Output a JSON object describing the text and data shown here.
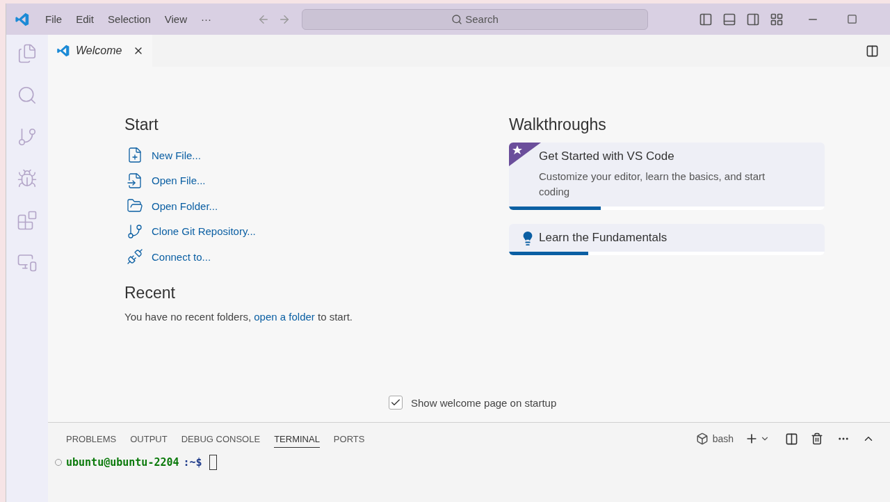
{
  "menu": [
    "File",
    "Edit",
    "Selection",
    "View",
    "···"
  ],
  "search": {
    "placeholder": "Search"
  },
  "editor_tabs": [
    {
      "label": "Welcome",
      "selected": true
    }
  ],
  "start": {
    "title": "Start",
    "items": [
      {
        "kind": "new-file",
        "label": "New File..."
      },
      {
        "kind": "open-file",
        "label": "Open File..."
      },
      {
        "kind": "open-folder",
        "label": "Open Folder..."
      },
      {
        "kind": "clone",
        "label": "Clone Git Repository..."
      },
      {
        "kind": "connect",
        "label": "Connect to..."
      }
    ]
  },
  "recent": {
    "title": "Recent",
    "text_before": "You have no recent folders,",
    "link": "open a folder",
    "text_after": "to start."
  },
  "walkthroughs": {
    "title": "Walkthroughs",
    "items": [
      {
        "kind": "featured",
        "title": "Get Started with VS Code",
        "description": "Customize your editor, learn the basics, and start coding",
        "level": 0.29
      },
      {
        "kind": "bulb",
        "title": "Learn the Fundamentals",
        "level": 0.25
      }
    ]
  },
  "show_on_startup": {
    "label": "Show welcome page on startup",
    "checked": true
  },
  "panel_tabs": [
    {
      "label": "PROBLEMS",
      "selected": false
    },
    {
      "label": "OUTPUT",
      "selected": false
    },
    {
      "label": "DEBUG CONSOLE",
      "selected": false
    },
    {
      "label": "TERMINAL",
      "selected": true
    },
    {
      "label": "PORTS",
      "selected": false
    }
  ],
  "terminal": {
    "shell": "bash",
    "user_host": "ubuntu@ubuntu-2204",
    "path": ":~$"
  }
}
